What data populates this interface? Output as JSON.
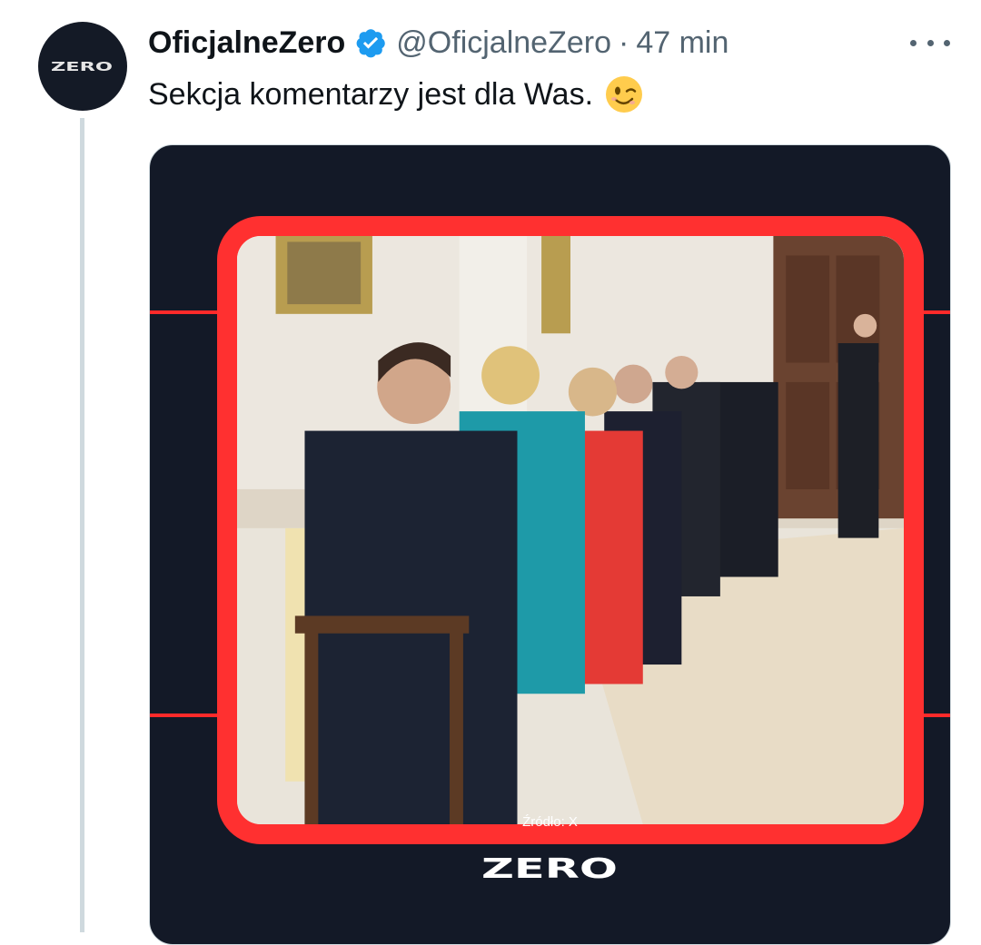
{
  "tweet": {
    "display_name": "OficjalneZero",
    "handle": "@OficjalneZero",
    "separator": "·",
    "time": "47 min",
    "text": "Sekcja komentarzy jest dla Was.",
    "emoji": "winking-face",
    "verified": true,
    "avatar_logo": "ZERO"
  },
  "media": {
    "source_caption": "Źródło: X",
    "brand_logo": "ZERO",
    "accent_color": "#ff3030",
    "background_color": "#131927"
  },
  "icons": {
    "more": "more-horizontal-icon",
    "verified": "verified-badge-icon"
  },
  "colors": {
    "verified_blue": "#1d9bf0",
    "muted_text": "#536471",
    "thread_line": "#cfd9de"
  }
}
